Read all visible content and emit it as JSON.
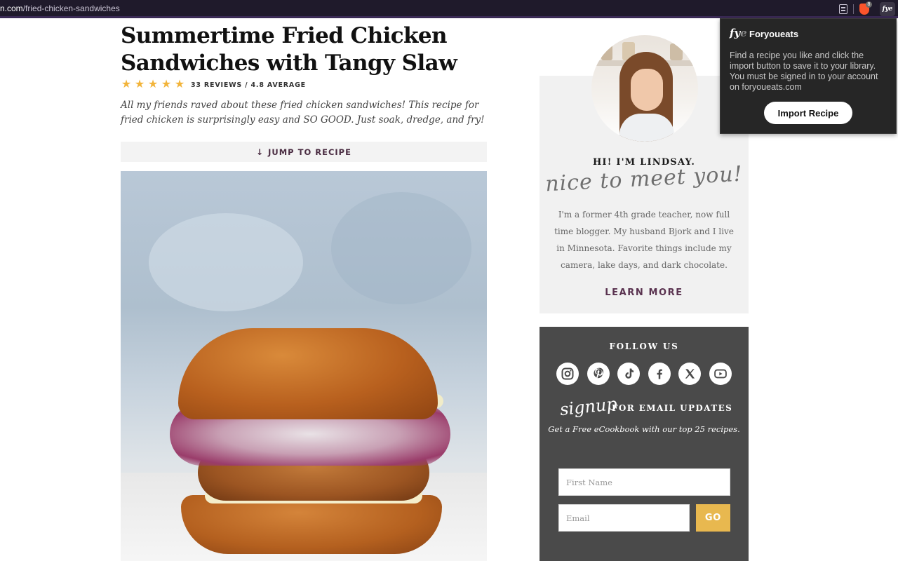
{
  "browser": {
    "url_domain": "n.com",
    "url_path": "/fried-chicken-sandwiches",
    "brave_badge": "8",
    "extension_icon_label": "fye"
  },
  "post": {
    "title": "Summertime Fried Chicken Sandwiches with Tangy Slaw",
    "stars": 5,
    "rating_text": "33 REVIEWS / 4.8 AVERAGE",
    "intro": "All my friends raved about these fried chicken sandwiches! This recipe for fried chicken is surprisingly easy and SO GOOD. Just soak, dredge, and fry!",
    "jump_icon": "↓",
    "jump_label": "JUMP TO RECIPE"
  },
  "about": {
    "greeting": "HI! I'M LINDSAY.",
    "script": "nice to meet you!",
    "bio": "I'm a former 4th grade teacher, now full time blogger. My husband Bjork and I live in Minnesota. Favorite things include my camera, lake days, and dark chocolate.",
    "learn_more": "LEARN MORE"
  },
  "follow": {
    "title": "FOLLOW US",
    "socials": [
      "instagram-icon",
      "pinterest-icon",
      "tiktok-icon",
      "facebook-icon",
      "x-icon",
      "youtube-icon"
    ],
    "signup_script": "signup",
    "signup_title": "FOR EMAIL UPDATES",
    "signup_sub": "Get a Free eCookbook with our top 25 recipes.",
    "first_name_placeholder": "First Name",
    "email_placeholder": "Email",
    "go_label": "GO"
  },
  "popup": {
    "logo": "fye",
    "title": "Foryoueats",
    "body": "Find a recipe you like and click the import button to save it to your library. You must be signed in to your account on foryoueats.com",
    "button": "Import Recipe"
  },
  "colors": {
    "accent_plum": "#5a3350",
    "star": "#f2b43a",
    "go_button": "#e8b84f",
    "follow_bg": "#4a4a4a",
    "about_bg": "#f1f1f1"
  }
}
